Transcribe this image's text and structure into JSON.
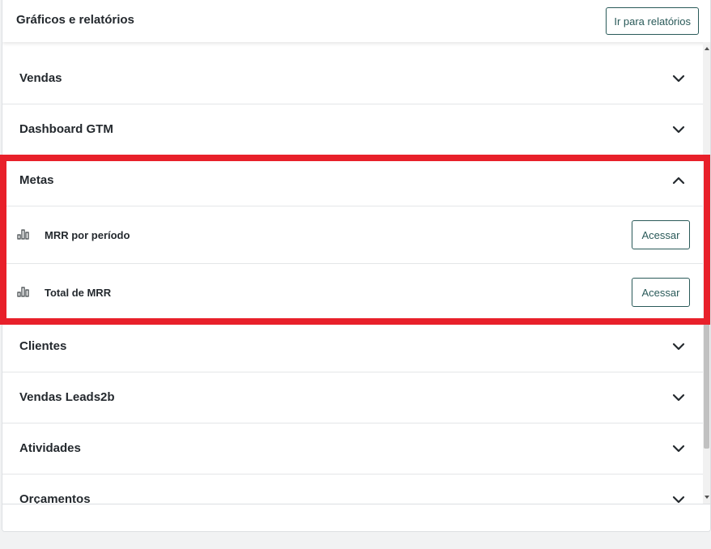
{
  "header": {
    "title": "Gráficos e relatórios",
    "reports_button": "Ir para relatórios"
  },
  "sections": [
    {
      "title": "Vendas",
      "expanded": false
    },
    {
      "title": "Dashboard GTM",
      "expanded": false
    },
    {
      "title": "Metas",
      "expanded": true,
      "items": [
        {
          "label": "MRR por período",
          "button": "Acessar"
        },
        {
          "label": "Total de MRR",
          "button": "Acessar"
        }
      ]
    },
    {
      "title": "Clientes",
      "expanded": false
    },
    {
      "title": "Vendas Leads2b",
      "expanded": false
    },
    {
      "title": "Atividades",
      "expanded": false
    },
    {
      "title": "Orçamentos",
      "expanded": false
    }
  ],
  "colors": {
    "accent": "#2a5a59",
    "highlight": "#e8202a",
    "text": "#24292e",
    "divider": "#e4e6e8"
  },
  "icons": {
    "collapsed": "chevron-down-icon",
    "expanded": "chevron-up-icon",
    "report": "bar-chart-icon"
  }
}
